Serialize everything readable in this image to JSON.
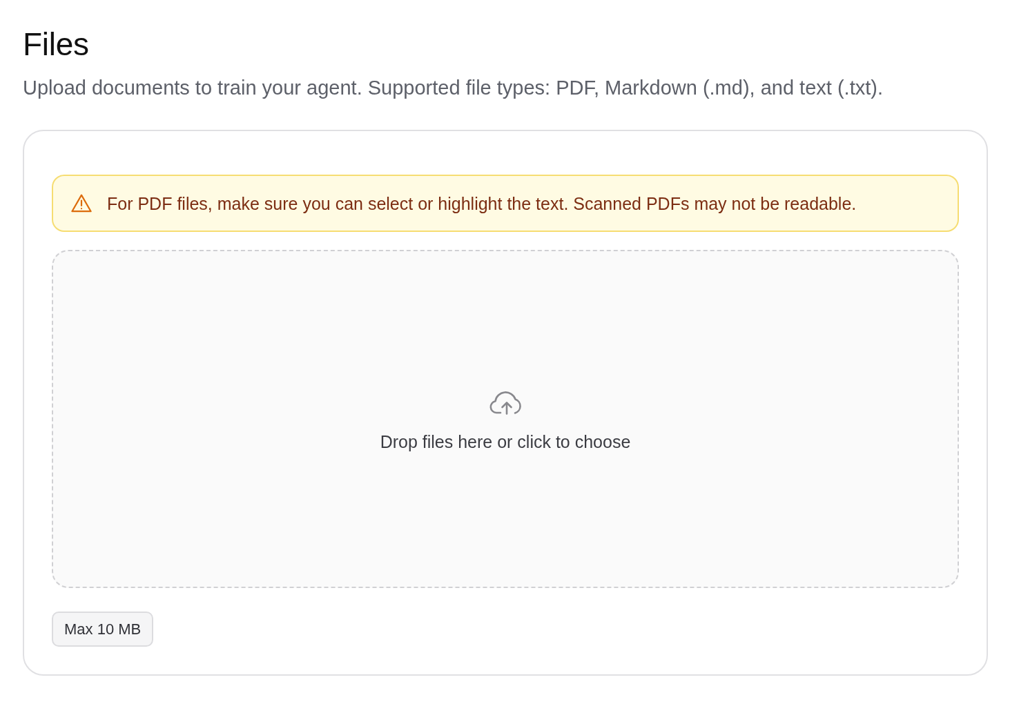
{
  "page": {
    "title": "Files",
    "description": "Upload documents to train your agent. Supported file types: PDF, Markdown (.md), and text (.txt)."
  },
  "upload_card": {
    "notice": {
      "kind": "warning",
      "text": "For PDF files, make sure you can select or highlight the text. Scanned PDFs may not be readable."
    },
    "dropzone": {
      "prompt": "Drop files here or click to choose"
    },
    "size_limit": "Max 10 MB"
  }
}
